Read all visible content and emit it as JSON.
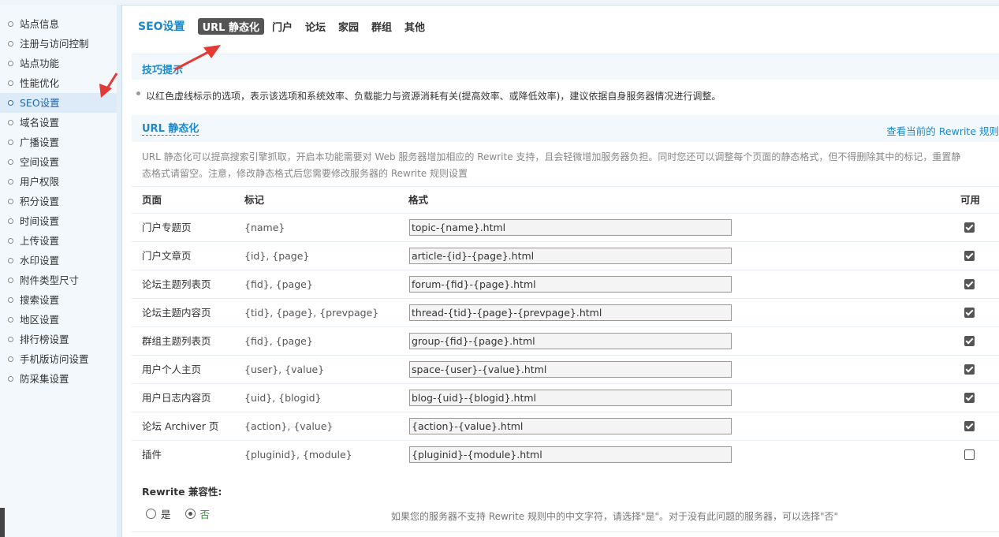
{
  "sidebar": {
    "items": [
      {
        "label": "站点信息"
      },
      {
        "label": "注册与访问控制"
      },
      {
        "label": "站点功能"
      },
      {
        "label": "性能优化"
      },
      {
        "label": "SEO设置"
      },
      {
        "label": "域名设置"
      },
      {
        "label": "广播设置"
      },
      {
        "label": "空间设置"
      },
      {
        "label": "用户权限"
      },
      {
        "label": "积分设置"
      },
      {
        "label": "时间设置"
      },
      {
        "label": "上传设置"
      },
      {
        "label": "水印设置"
      },
      {
        "label": "附件类型尺寸"
      },
      {
        "label": "搜索设置"
      },
      {
        "label": "地区设置"
      },
      {
        "label": "排行榜设置"
      },
      {
        "label": "手机版访问设置"
      },
      {
        "label": "防采集设置"
      }
    ],
    "active_index": 4
  },
  "header": {
    "title": "SEO设置",
    "tabs": [
      "URL 静态化",
      "门户",
      "论坛",
      "家园",
      "群组",
      "其他"
    ],
    "active_tab": 0
  },
  "tips": {
    "title": "技巧提示",
    "text": "以红色虚线标示的选项，表示该选项和系统效率、负载能力与资源消耗有关(提高效率、或降低效率)，建议依据自身服务器情况进行调整。"
  },
  "section": {
    "title": "URL 静态化",
    "link": "查看当前的 Rewrite 规则",
    "description": "URL 静态化可以提高搜索引擎抓取，开启本功能需要对 Web 服务器增加相应的 Rewrite 支持，且会轻微增加服务器负担。同时您还可以调整每个页面的静态格式，但不得删除其中的标记，重置静态格式请留空。注意，修改静态格式后您需要修改服务器的 Rewrite 规则设置"
  },
  "table": {
    "headers": {
      "page": "页面",
      "mark": "标记",
      "format": "格式",
      "enabled": "可用"
    },
    "rows": [
      {
        "page": "门户专题页",
        "mark": "{name}",
        "format": "topic-{name}.html",
        "enabled": true
      },
      {
        "page": "门户文章页",
        "mark": "{id}, {page}",
        "format": "article-{id}-{page}.html",
        "enabled": true
      },
      {
        "page": "论坛主题列表页",
        "mark": "{fid}, {page}",
        "format": "forum-{fid}-{page}.html",
        "enabled": true
      },
      {
        "page": "论坛主题内容页",
        "mark": "{tid}, {page}, {prevpage}",
        "format": "thread-{tid}-{page}-{prevpage}.html",
        "enabled": true
      },
      {
        "page": "群组主题列表页",
        "mark": "{fid}, {page}",
        "format": "group-{fid}-{page}.html",
        "enabled": true
      },
      {
        "page": "用户个人主页",
        "mark": "{user}, {value}",
        "format": "space-{user}-{value}.html",
        "enabled": true
      },
      {
        "page": "用户日志内容页",
        "mark": "{uid}, {blogid}",
        "format": "blog-{uid}-{blogid}.html",
        "enabled": true
      },
      {
        "page": "论坛 Archiver 页",
        "mark": "{action}, {value}",
        "format": "{action}-{value}.html",
        "enabled": true
      },
      {
        "page": "插件",
        "mark": "{pluginid}, {module}",
        "format": "{pluginid}-{module}.html",
        "enabled": false
      }
    ]
  },
  "compat": {
    "title": "Rewrite 兼容性:",
    "yes_label": "是",
    "no_label": "否",
    "selected": "no",
    "hint": "如果您的服务器不支持 Rewrite 规则中的中文字符，请选择\"是\"。对于没有此问题的服务器，可以选择\"否\""
  },
  "colors": {
    "accent": "#1e88c8",
    "annotation_arrow": "#e53935"
  }
}
